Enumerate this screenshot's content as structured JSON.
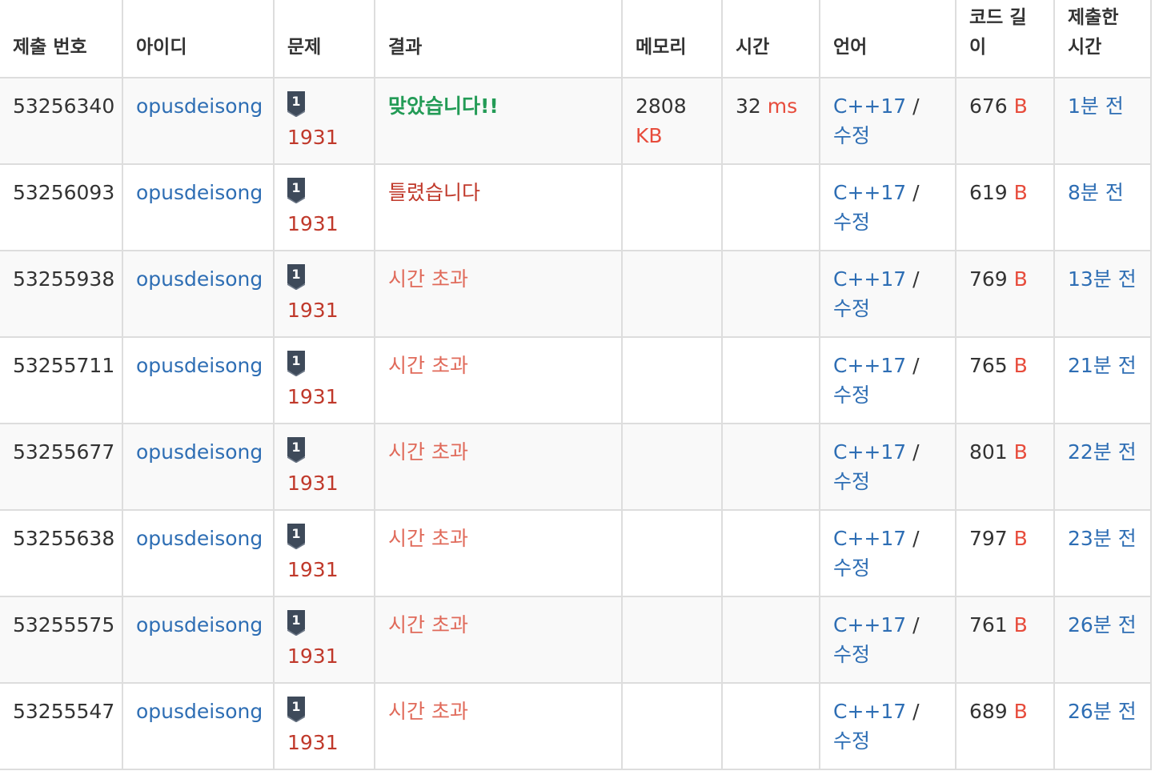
{
  "colors": {
    "link": "#2e6eb4",
    "problem": "#c0392b",
    "accepted": "#239b56",
    "wrong": "#c0392b",
    "time_limit": "#e06a5a",
    "unit": "#e74c3c",
    "tier_badge": "#3e4a5a"
  },
  "headers": {
    "submission_id": "제출 번호",
    "user_id": "아이디",
    "problem": "문제",
    "result": "결과",
    "memory": "메모리",
    "time": "시간",
    "language": "언어",
    "code_length": "코드 길이",
    "submitted_at": "제출한 시간"
  },
  "rows": [
    {
      "id": "53256340",
      "user": "opusdeisong",
      "tier_icon": "silver-1-tier-icon",
      "tier": "1",
      "problem": "1931",
      "result": "맞았습니다!!",
      "result_type": "ac",
      "memory": "2808",
      "memory_unit": "KB",
      "time": "32",
      "time_unit": "ms",
      "lang": "C++17",
      "sep": "/",
      "edit": "수정",
      "length": "676",
      "length_unit": "B",
      "ago": "1분 전"
    },
    {
      "id": "53256093",
      "user": "opusdeisong",
      "tier_icon": "silver-1-tier-icon",
      "tier": "1",
      "problem": "1931",
      "result": "틀렸습니다",
      "result_type": "wa",
      "memory": "",
      "memory_unit": "",
      "time": "",
      "time_unit": "",
      "lang": "C++17",
      "sep": "/",
      "edit": "수정",
      "length": "619",
      "length_unit": "B",
      "ago": "8분 전"
    },
    {
      "id": "53255938",
      "user": "opusdeisong",
      "tier_icon": "silver-1-tier-icon",
      "tier": "1",
      "problem": "1931",
      "result": "시간 초과",
      "result_type": "tle",
      "memory": "",
      "memory_unit": "",
      "time": "",
      "time_unit": "",
      "lang": "C++17",
      "sep": "/",
      "edit": "수정",
      "length": "769",
      "length_unit": "B",
      "ago": "13분 전"
    },
    {
      "id": "53255711",
      "user": "opusdeisong",
      "tier_icon": "silver-1-tier-icon",
      "tier": "1",
      "problem": "1931",
      "result": "시간 초과",
      "result_type": "tle",
      "memory": "",
      "memory_unit": "",
      "time": "",
      "time_unit": "",
      "lang": "C++17",
      "sep": "/",
      "edit": "수정",
      "length": "765",
      "length_unit": "B",
      "ago": "21분 전"
    },
    {
      "id": "53255677",
      "user": "opusdeisong",
      "tier_icon": "silver-1-tier-icon",
      "tier": "1",
      "problem": "1931",
      "result": "시간 초과",
      "result_type": "tle",
      "memory": "",
      "memory_unit": "",
      "time": "",
      "time_unit": "",
      "lang": "C++17",
      "sep": "/",
      "edit": "수정",
      "length": "801",
      "length_unit": "B",
      "ago": "22분 전"
    },
    {
      "id": "53255638",
      "user": "opusdeisong",
      "tier_icon": "silver-1-tier-icon",
      "tier": "1",
      "problem": "1931",
      "result": "시간 초과",
      "result_type": "tle",
      "memory": "",
      "memory_unit": "",
      "time": "",
      "time_unit": "",
      "lang": "C++17",
      "sep": "/",
      "edit": "수정",
      "length": "797",
      "length_unit": "B",
      "ago": "23분 전"
    },
    {
      "id": "53255575",
      "user": "opusdeisong",
      "tier_icon": "silver-1-tier-icon",
      "tier": "1",
      "problem": "1931",
      "result": "시간 초과",
      "result_type": "tle",
      "memory": "",
      "memory_unit": "",
      "time": "",
      "time_unit": "",
      "lang": "C++17",
      "sep": "/",
      "edit": "수정",
      "length": "761",
      "length_unit": "B",
      "ago": "26분 전"
    },
    {
      "id": "53255547",
      "user": "opusdeisong",
      "tier_icon": "silver-1-tier-icon",
      "tier": "1",
      "problem": "1931",
      "result": "시간 초과",
      "result_type": "tle",
      "memory": "",
      "memory_unit": "",
      "time": "",
      "time_unit": "",
      "lang": "C++17",
      "sep": "/",
      "edit": "수정",
      "length": "689",
      "length_unit": "B",
      "ago": "26분 전"
    }
  ]
}
